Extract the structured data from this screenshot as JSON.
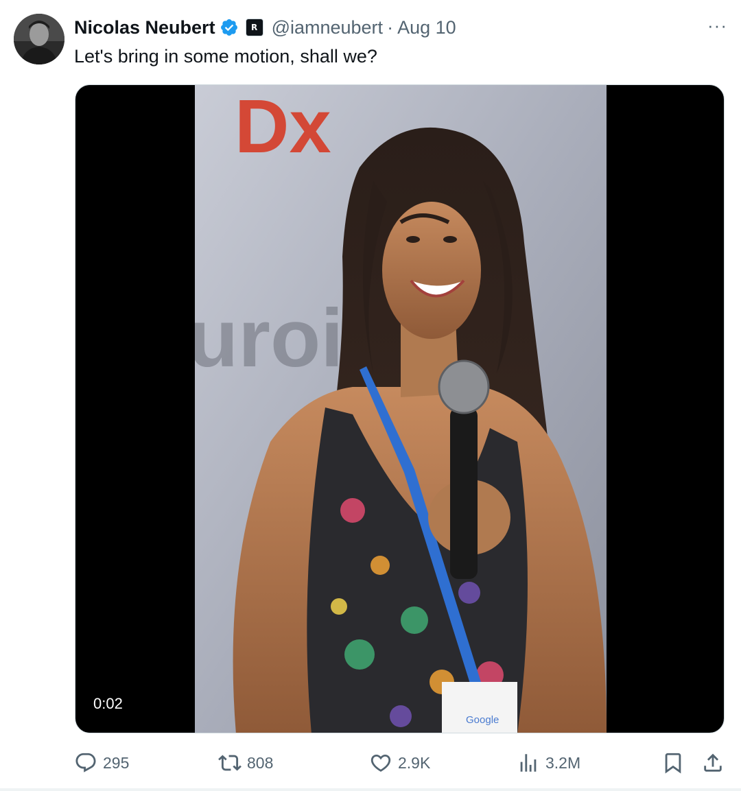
{
  "tweet": {
    "author": {
      "display_name": "Nicolas Neubert",
      "handle": "@iamneubert",
      "verified": true,
      "affiliation_badge": "R"
    },
    "separator": "·",
    "date": "Aug 10",
    "more_label": "···",
    "text": "Let's bring in some motion, shall we?",
    "media": {
      "type": "video",
      "timestamp": "0:02",
      "backdrop_text": [
        "Dx",
        "uroi"
      ],
      "badge_text": "Google"
    },
    "actions": {
      "replies": "295",
      "reposts": "808",
      "likes": "2.9K",
      "views": "3.2M"
    },
    "colors": {
      "text": "#0f1419",
      "secondary": "#536471",
      "verified": "#1d9bf0",
      "border": "#cfd9de"
    },
    "icons": [
      "verified-badge-icon",
      "more-icon",
      "reply-icon",
      "repost-icon",
      "like-icon",
      "views-icon",
      "bookmark-icon",
      "share-icon"
    ]
  }
}
